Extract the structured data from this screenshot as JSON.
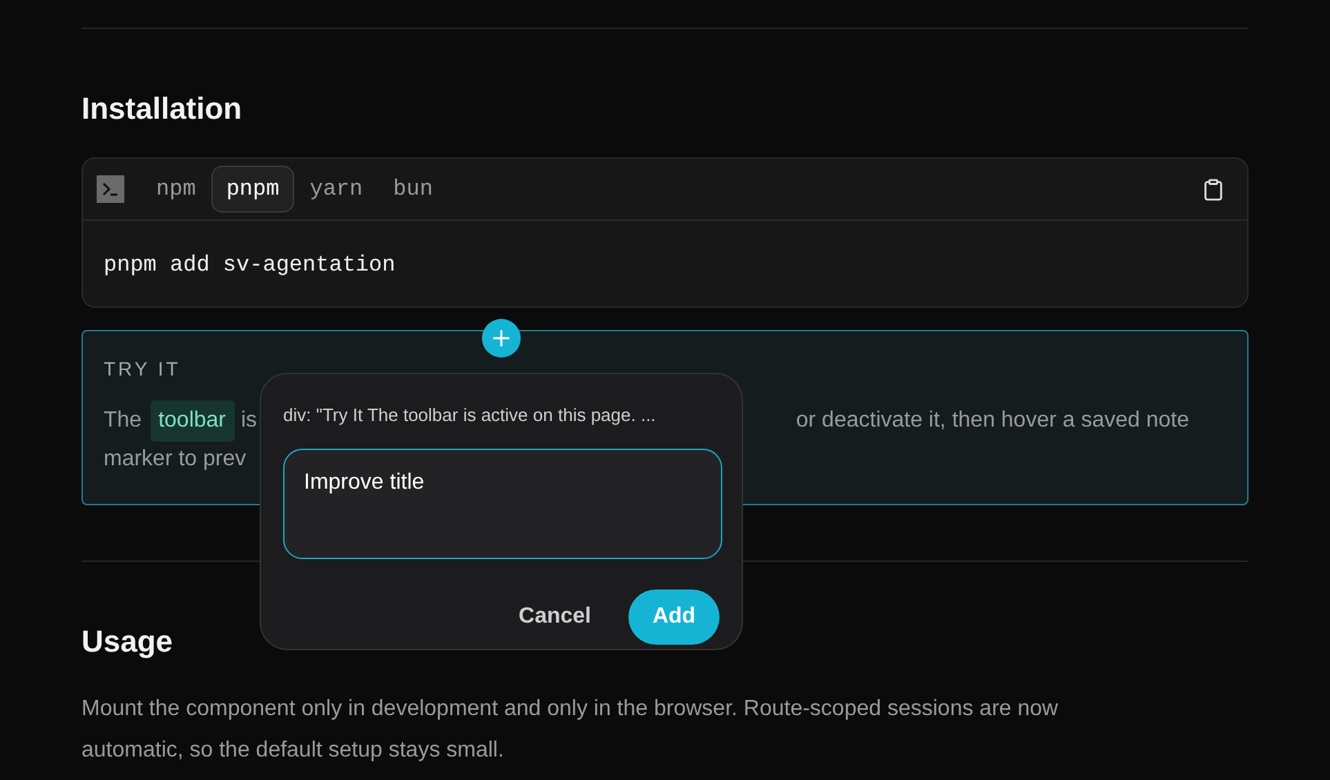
{
  "installation": {
    "heading": "Installation",
    "tabs": [
      {
        "label": "npm",
        "selected": false
      },
      {
        "label": "pnpm",
        "selected": true
      },
      {
        "label": "yarn",
        "selected": false
      },
      {
        "label": "bun",
        "selected": false
      }
    ],
    "command": "pnpm add sv-agentation"
  },
  "try_it": {
    "label": "TRY IT",
    "line_1": [
      {
        "text": "The",
        "kind": "plain"
      },
      {
        "text": "toolbar",
        "kind": "highlight"
      },
      {
        "text": "is",
        "kind": "plain"
      },
      {
        "text": "or deactivate it, then hover a saved note",
        "kind": "plain"
      }
    ],
    "line_2": "marker to prev"
  },
  "annotation_popup": {
    "target": "div: \"Try It The toolbar is active on this page. ...",
    "value": "Improve title",
    "buttons": [
      {
        "label": "Cancel",
        "kind": "secondary"
      },
      {
        "label": "Add",
        "kind": "primary"
      }
    ]
  },
  "usage": {
    "heading": "Usage",
    "text": "Mount the component only in development and only in the browser. Route-scoped sessions are now automatic, so the default setup stays small."
  }
}
